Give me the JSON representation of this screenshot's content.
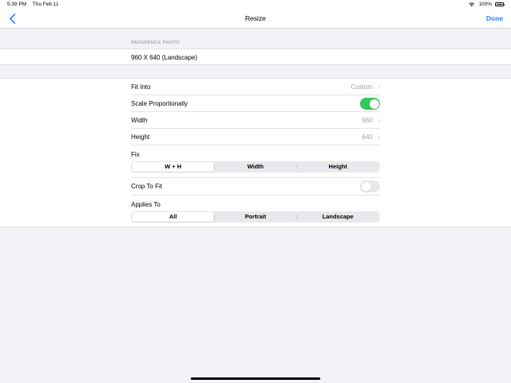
{
  "status_bar": {
    "time": "5:39 PM",
    "date": "Thu Feb 11",
    "battery": "100%"
  },
  "nav": {
    "title": "Resize",
    "done_label": "Done",
    "back_icon": "chevron-left-icon"
  },
  "reference": {
    "header": "REFERENCE PHOTO",
    "value": "960 X 640 (Landscape)"
  },
  "rows": {
    "fit_into": {
      "label": "Fit Into",
      "value": "Custom"
    },
    "scale": {
      "label": "Scale Proportionally",
      "enabled": true
    },
    "width": {
      "label": "Width",
      "value": "960"
    },
    "height": {
      "label": "Height",
      "value": "640"
    },
    "crop": {
      "label": "Crop To Fit",
      "enabled": false
    }
  },
  "fix": {
    "label": "Fix",
    "options": [
      "W + H",
      "Width",
      "Height"
    ],
    "selected": "W + H"
  },
  "applies_to": {
    "label": "Applies To",
    "options": [
      "All",
      "Portrait",
      "Landscape"
    ],
    "selected": "All"
  },
  "colors": {
    "accent": "#2f7cf6",
    "toggle_on": "#34c759",
    "background": "#f2f2f7"
  }
}
